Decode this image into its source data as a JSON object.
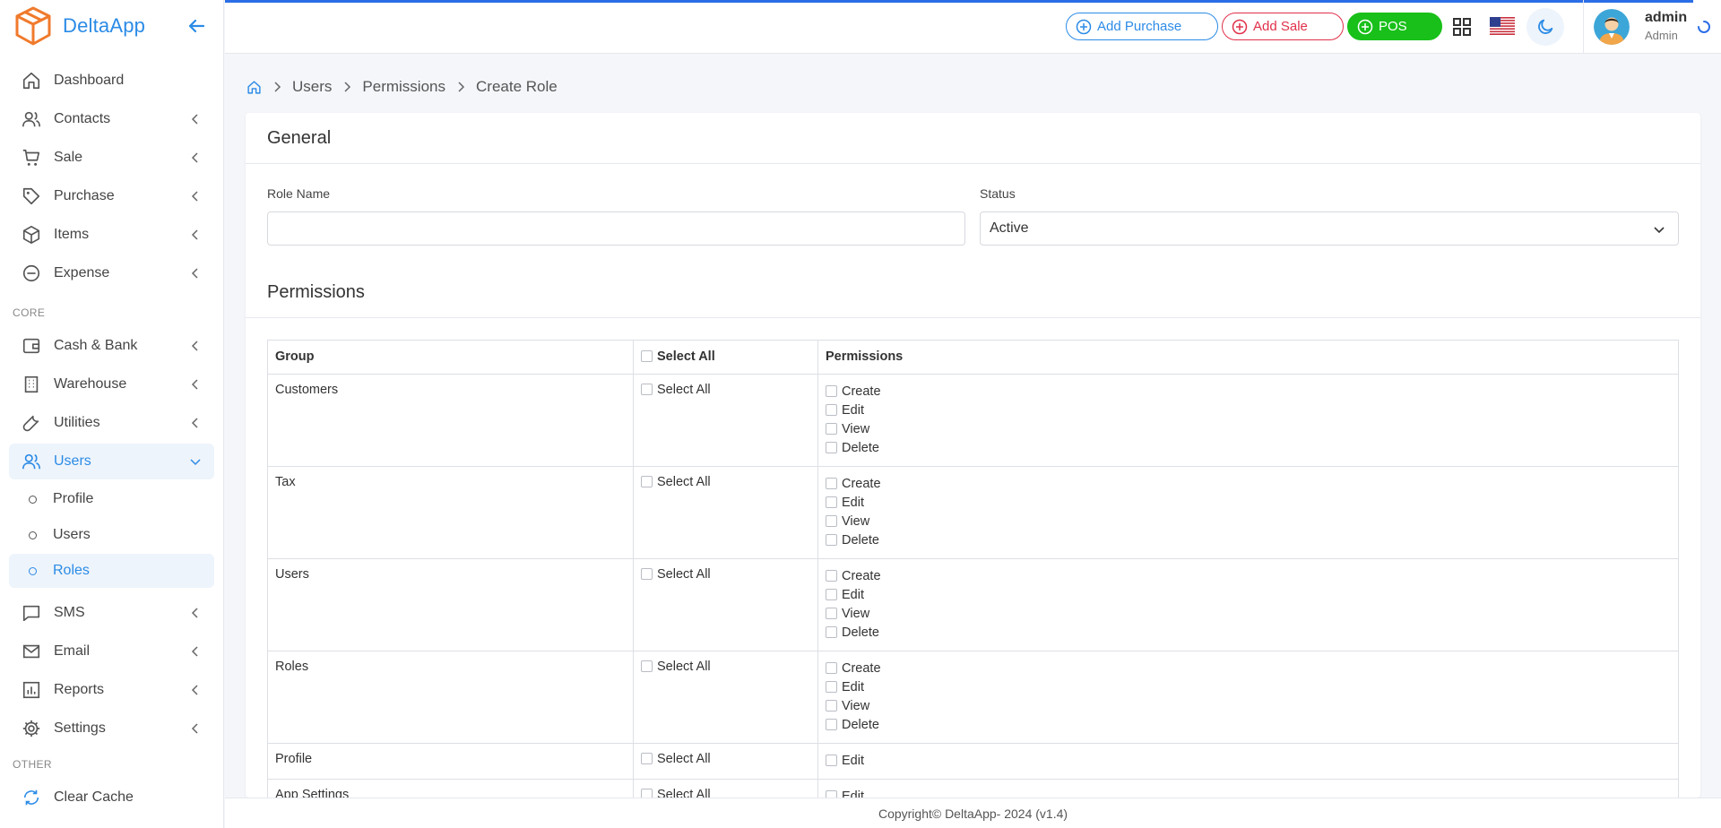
{
  "app": {
    "name": "DeltaApp"
  },
  "sidebar": {
    "items": [
      {
        "label": "Dashboard",
        "icon": "home-icon",
        "chevron": false
      },
      {
        "label": "Contacts",
        "icon": "users-icon",
        "chevron": true
      },
      {
        "label": "Sale",
        "icon": "cart-icon",
        "chevron": true
      },
      {
        "label": "Purchase",
        "icon": "tag-icon",
        "chevron": true
      },
      {
        "label": "Items",
        "icon": "box-icon",
        "chevron": true
      },
      {
        "label": "Expense",
        "icon": "minus-circle-icon",
        "chevron": true
      }
    ],
    "core_label": "CORE",
    "core_items": [
      {
        "label": "Cash & Bank",
        "icon": "wallet-icon"
      },
      {
        "label": "Warehouse",
        "icon": "building-icon"
      },
      {
        "label": "Utilities",
        "icon": "wrench-icon"
      }
    ],
    "users_label": "Users",
    "users_sub": [
      "Profile",
      "Users",
      "Roles"
    ],
    "more_items": [
      {
        "label": "SMS",
        "icon": "chat-icon"
      },
      {
        "label": "Email",
        "icon": "mail-icon"
      },
      {
        "label": "Reports",
        "icon": "chart-icon"
      },
      {
        "label": "Settings",
        "icon": "gear-icon"
      }
    ],
    "other_label": "OTHER",
    "clear_cache": "Clear Cache"
  },
  "topbar": {
    "add_purchase": "Add Purchase",
    "add_sale": "Add Sale",
    "pos": "POS",
    "user_name": "admin",
    "user_role": "Admin"
  },
  "breadcrumb": [
    "Users",
    "Permissions",
    "Create Role"
  ],
  "general": {
    "title": "General",
    "role_name_label": "Role Name",
    "role_name_value": "",
    "status_label": "Status",
    "status_value": "Active"
  },
  "permissions": {
    "title": "Permissions",
    "headers": {
      "group": "Group",
      "select_all": "Select All",
      "permissions": "Permissions"
    },
    "select_all_label": "Select All",
    "rows": [
      {
        "group": "Customers",
        "perms": [
          "Create",
          "Edit",
          "View",
          "Delete"
        ]
      },
      {
        "group": "Tax",
        "perms": [
          "Create",
          "Edit",
          "View",
          "Delete"
        ]
      },
      {
        "group": "Users",
        "perms": [
          "Create",
          "Edit",
          "View",
          "Delete"
        ]
      },
      {
        "group": "Roles",
        "perms": [
          "Create",
          "Edit",
          "View",
          "Delete"
        ]
      },
      {
        "group": "Profile",
        "perms": [
          "Edit"
        ]
      },
      {
        "group": "App Settings",
        "perms": [
          "Edit"
        ]
      }
    ]
  },
  "footer": {
    "text": "Copyright© DeltaApp- 2024 (v1.4)"
  },
  "colors": {
    "accent": "#2b8be6",
    "sale": "#e0304a",
    "pos": "#18c019"
  }
}
